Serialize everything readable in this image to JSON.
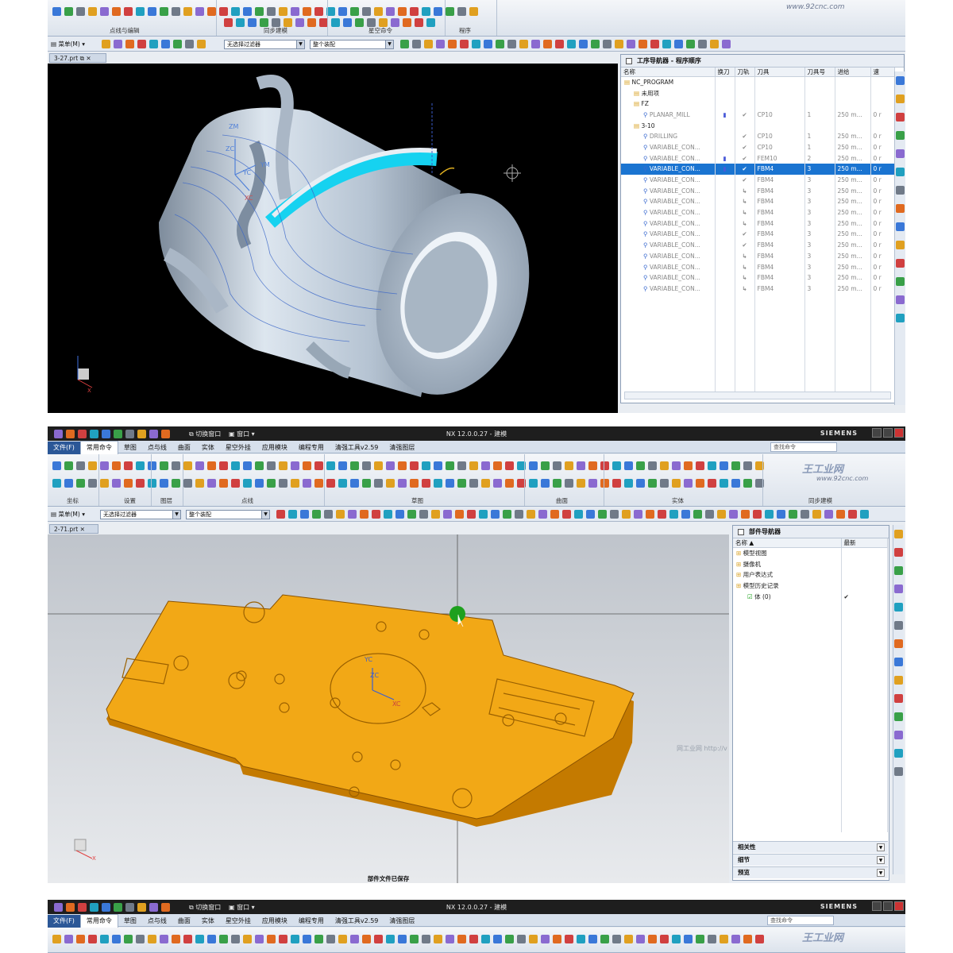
{
  "panel1": {
    "watermark": "www.92cnc.com",
    "groups": [
      "点线与编辑",
      "同步建模",
      "星空命令",
      "程序"
    ],
    "toolbar": {
      "menu_label": "菜单(M)",
      "filter_label": "无选择过滤器",
      "assembly_label": "整个装配"
    },
    "doc_tab": "3-27.prt",
    "navigator": {
      "title": "工序导航器 - 程序顺序",
      "columns": [
        "名称",
        "换刀",
        "刀轨",
        "刀具",
        "刀具号",
        "进给",
        "速"
      ],
      "rows": [
        {
          "name": "NC_PROGRAM",
          "indent": 0,
          "tool_change": "",
          "path": "",
          "tool": "",
          "tool_no": "",
          "feed": "",
          "speed": "",
          "dark": true
        },
        {
          "name": "未用项",
          "indent": 1,
          "tool_change": "",
          "path": "",
          "tool": "",
          "tool_no": "",
          "feed": "",
          "speed": "",
          "dark": true
        },
        {
          "name": "FZ",
          "indent": 1,
          "tool_change": "",
          "path": "",
          "tool": "",
          "tool_no": "",
          "feed": "",
          "speed": "",
          "dark": true
        },
        {
          "name": "PLANAR_MILL",
          "indent": 2,
          "tool_change": "▮",
          "path": "✔",
          "tool": "CP10",
          "tool_no": "1",
          "feed": "250 m...",
          "speed": "0 r"
        },
        {
          "name": "3-10",
          "indent": 1,
          "tool_change": "",
          "path": "",
          "tool": "",
          "tool_no": "",
          "feed": "",
          "speed": "",
          "dark": true
        },
        {
          "name": "DRILLING",
          "indent": 2,
          "tool_change": "",
          "path": "✔",
          "tool": "CP10",
          "tool_no": "1",
          "feed": "250 m...",
          "speed": "0 r"
        },
        {
          "name": "VARIABLE_CON...",
          "indent": 2,
          "tool_change": "",
          "path": "✔",
          "tool": "CP10",
          "tool_no": "1",
          "feed": "250 m...",
          "speed": "0 r"
        },
        {
          "name": "VARIABLE_CON...",
          "indent": 2,
          "tool_change": "▮",
          "path": "✔",
          "tool": "FEM10",
          "tool_no": "2",
          "feed": "250 m...",
          "speed": "0 r"
        },
        {
          "name": "VARIABLE_CON...",
          "indent": 2,
          "tool_change": "▮",
          "path": "✔",
          "tool": "FBM4",
          "tool_no": "3",
          "feed": "250 m...",
          "speed": "0 r",
          "selected": true
        },
        {
          "name": "VARIABLE_CON...",
          "indent": 2,
          "tool_change": "",
          "path": "✔",
          "tool": "FBM4",
          "tool_no": "3",
          "feed": "250 m...",
          "speed": "0 r"
        },
        {
          "name": "VARIABLE_CON...",
          "indent": 2,
          "tool_change": "",
          "path": "↳",
          "tool": "FBM4",
          "tool_no": "3",
          "feed": "250 m...",
          "speed": "0 r"
        },
        {
          "name": "VARIABLE_CON...",
          "indent": 2,
          "tool_change": "",
          "path": "↳",
          "tool": "FBM4",
          "tool_no": "3",
          "feed": "250 m...",
          "speed": "0 r"
        },
        {
          "name": "VARIABLE_CON...",
          "indent": 2,
          "tool_change": "",
          "path": "↳",
          "tool": "FBM4",
          "tool_no": "3",
          "feed": "250 m...",
          "speed": "0 r"
        },
        {
          "name": "VARIABLE_CON...",
          "indent": 2,
          "tool_change": "",
          "path": "↳",
          "tool": "FBM4",
          "tool_no": "3",
          "feed": "250 m...",
          "speed": "0 r"
        },
        {
          "name": "VARIABLE_CON...",
          "indent": 2,
          "tool_change": "",
          "path": "✔",
          "tool": "FBM4",
          "tool_no": "3",
          "feed": "250 m...",
          "speed": "0 r"
        },
        {
          "name": "VARIABLE_CON...",
          "indent": 2,
          "tool_change": "",
          "path": "✔",
          "tool": "FBM4",
          "tool_no": "3",
          "feed": "250 m...",
          "speed": "0 r"
        },
        {
          "name": "VARIABLE_CON...",
          "indent": 2,
          "tool_change": "",
          "path": "↳",
          "tool": "FBM4",
          "tool_no": "3",
          "feed": "250 m...",
          "speed": "0 r"
        },
        {
          "name": "VARIABLE_CON...",
          "indent": 2,
          "tool_change": "",
          "path": "↳",
          "tool": "FBM4",
          "tool_no": "3",
          "feed": "250 m...",
          "speed": "0 r"
        },
        {
          "name": "VARIABLE_CON...",
          "indent": 2,
          "tool_change": "",
          "path": "↳",
          "tool": "FBM4",
          "tool_no": "3",
          "feed": "250 m...",
          "speed": "0 r"
        },
        {
          "name": "VARIABLE_CON...",
          "indent": 2,
          "tool_change": "",
          "path": "↳",
          "tool": "FBM4",
          "tool_no": "3",
          "feed": "250 m...",
          "speed": "0 r"
        }
      ]
    },
    "axes": {
      "zm": "ZM",
      "zc": "ZC",
      "xc": "XC",
      "yc": "YC",
      "ym": "YM",
      "x": "X"
    }
  },
  "panel2": {
    "title": "NX 12.0.0.27 - 建模",
    "brand": "SIEMENS",
    "quick": {
      "switch": "切换窗口",
      "window": "窗口"
    },
    "menu": [
      "文件(F)",
      "常用命令",
      "草图",
      "点与线",
      "曲面",
      "实体",
      "星空外挂",
      "应用模块",
      "编程专用",
      "清强工具v2.59",
      "清强图层"
    ],
    "search_placeholder": "查找命令",
    "groups": [
      "坐标",
      "设置",
      "图层",
      "点线",
      "草图",
      "曲面",
      "实体",
      "同步建模"
    ],
    "watermark": "王工业网",
    "watermark2": "www.92cnc.com",
    "toolbar": {
      "menu_label": "菜单(M)",
      "filter_label": "无选择过滤器",
      "assembly_label": "整个装配"
    },
    "doc_tab": "2-71.prt",
    "part_nav": {
      "title": "部件导航器",
      "columns": [
        "名称",
        "最新"
      ],
      "rows": [
        {
          "label": "模型视图",
          "indent": 0,
          "latest": ""
        },
        {
          "label": "摄像机",
          "indent": 0,
          "latest": ""
        },
        {
          "label": "用户表达式",
          "indent": 0,
          "latest": ""
        },
        {
          "label": "模型历史记录",
          "indent": 0,
          "latest": ""
        },
        {
          "label": "体 (0)",
          "indent": 1,
          "latest": "✔"
        }
      ],
      "sections": [
        "相关性",
        "细节",
        "预览"
      ]
    },
    "status": "部件文件已保存",
    "axes": {
      "yc": "YC",
      "zc": "ZC",
      "xc": "XC",
      "x": "X"
    },
    "faint_text": "网工业网 http://v"
  },
  "panel3": {
    "title": "NX 12.0.0.27 - 建模",
    "brand": "SIEMENS",
    "quick": {
      "switch": "切换窗口",
      "window": "窗口"
    },
    "menu": [
      "文件(F)",
      "常用命令",
      "草图",
      "点与线",
      "曲面",
      "实体",
      "星空外挂",
      "应用模块",
      "编程专用",
      "清强工具v2.59",
      "清强图层"
    ],
    "search_placeholder": "查找命令",
    "watermark": "王工业网"
  }
}
